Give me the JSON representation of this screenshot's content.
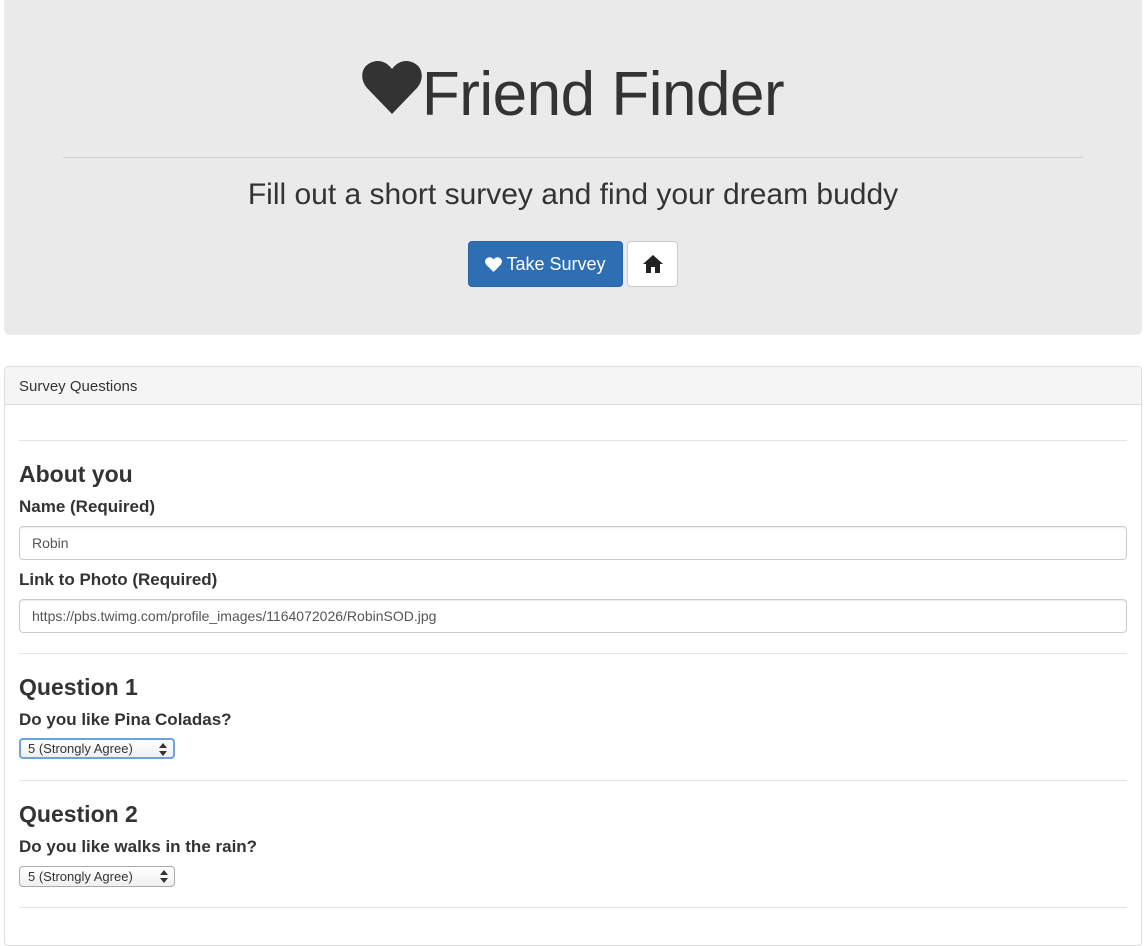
{
  "header": {
    "title": "Friend Finder",
    "lead": "Fill out a short survey and find your dream buddy",
    "take_survey_label": "Take Survey",
    "icons": [
      "heart-icon",
      "home-icon"
    ]
  },
  "panel": {
    "heading": "Survey Questions",
    "about": {
      "title": "About you",
      "name_label": "Name (Required)",
      "name_value": "Robin",
      "photo_label": "Link to Photo (Required)",
      "photo_value": "https://pbs.twimg.com/profile_images/1164072026/RobinSOD.jpg"
    },
    "questions": [
      {
        "title": "Question 1",
        "text": "Do you like Pina Coladas?",
        "selected": "5 (Strongly Agree)"
      },
      {
        "title": "Question 2",
        "text": "Do you like walks in the rain?",
        "selected": "5 (Strongly Agree)"
      }
    ]
  },
  "colors": {
    "jumbotron_bg": "#eaeaea",
    "primary": "#2e6eb3",
    "text": "#333333"
  }
}
